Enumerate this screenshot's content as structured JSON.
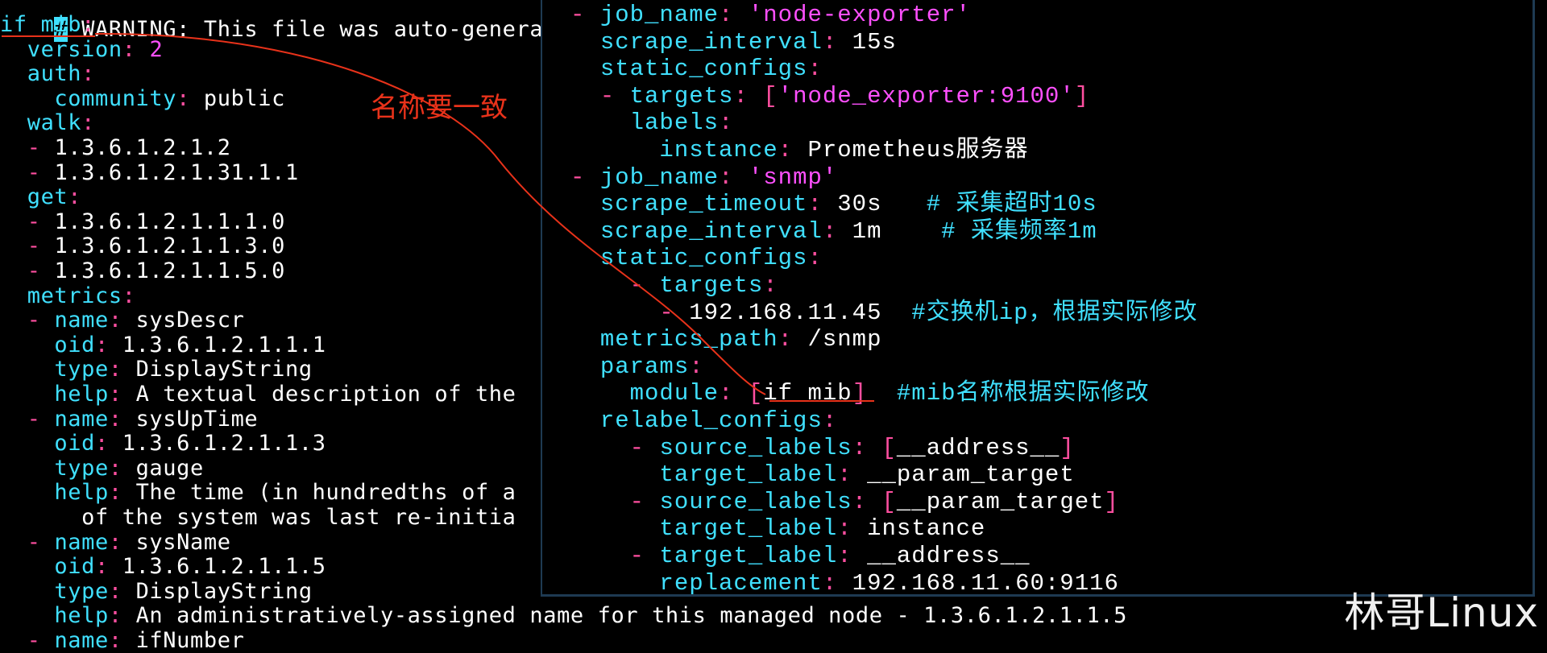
{
  "left_editor": {
    "warning": "# WARNING: This file was auto-generate",
    "lines": [
      {
        "indent": "",
        "key": "if_mib",
        "sep": ":",
        "val": "",
        "cursor": false
      },
      {
        "indent": "  ",
        "key": "version",
        "sep": ": ",
        "val": "2",
        "valtype": "num"
      },
      {
        "indent": "  ",
        "key": "auth",
        "sep": ":",
        "val": ""
      },
      {
        "indent": "    ",
        "key": "community",
        "sep": ": ",
        "val": "public"
      },
      {
        "indent": "  ",
        "key": "walk",
        "sep": ":",
        "val": ""
      },
      {
        "indent": "  ",
        "dash": "- ",
        "val": "1.3.6.1.2.1.2"
      },
      {
        "indent": "  ",
        "dash": "- ",
        "val": "1.3.6.1.2.1.31.1.1"
      },
      {
        "indent": "  ",
        "key": "get",
        "sep": ":",
        "val": ""
      },
      {
        "indent": "  ",
        "dash": "- ",
        "val": "1.3.6.1.2.1.1.1.0"
      },
      {
        "indent": "  ",
        "dash": "- ",
        "val": "1.3.6.1.2.1.1.3.0"
      },
      {
        "indent": "  ",
        "dash": "- ",
        "val": "1.3.6.1.2.1.1.5.0"
      },
      {
        "indent": "  ",
        "key": "metrics",
        "sep": ":",
        "val": ""
      },
      {
        "indent": "  ",
        "dash": "- ",
        "key": "name",
        "sep": ": ",
        "val": "sysDescr"
      },
      {
        "indent": "    ",
        "key": "oid",
        "sep": ": ",
        "val": "1.3.6.1.2.1.1.1"
      },
      {
        "indent": "    ",
        "key": "type",
        "sep": ": ",
        "val": "DisplayString"
      },
      {
        "indent": "    ",
        "key": "help",
        "sep": ": ",
        "val": "A textual description of the"
      },
      {
        "indent": "  ",
        "dash": "- ",
        "key": "name",
        "sep": ": ",
        "val": "sysUpTime"
      },
      {
        "indent": "    ",
        "key": "oid",
        "sep": ": ",
        "val": "1.3.6.1.2.1.1.3"
      },
      {
        "indent": "    ",
        "key": "type",
        "sep": ": ",
        "val": "gauge"
      },
      {
        "indent": "    ",
        "key": "help",
        "sep": ": ",
        "val": "The time (in hundredths of a"
      },
      {
        "indent": "      ",
        "val": "of the system was last re-initia"
      },
      {
        "indent": "  ",
        "dash": "- ",
        "key": "name",
        "sep": ": ",
        "val": "sysName"
      },
      {
        "indent": "    ",
        "key": "oid",
        "sep": ": ",
        "val": "1.3.6.1.2.1.1.5"
      },
      {
        "indent": "    ",
        "key": "type",
        "sep": ": ",
        "val": "DisplayString"
      },
      {
        "indent": "    ",
        "key": "help",
        "sep": ": ",
        "val": "An administratively-assigned name for this managed node - 1.3.6.1.2.1.1.5"
      },
      {
        "indent": "  ",
        "dash": "- ",
        "key": "name",
        "sep": ": ",
        "val": "ifNumber"
      }
    ]
  },
  "right_editor": {
    "lines": [
      {
        "indent": "",
        "dash": "- ",
        "key": "job_name",
        "sep": ": ",
        "val": "'node-exporter'",
        "valtype": "str"
      },
      {
        "indent": "  ",
        "key": "scrape_interval",
        "sep": ": ",
        "val": "15s"
      },
      {
        "indent": "  ",
        "key": "static_configs",
        "sep": ":",
        "val": ""
      },
      {
        "indent": "  ",
        "dash": "- ",
        "key": "targets",
        "sep": ": ",
        "val": "['node_exporter:9100']",
        "valtype": "str",
        "bracket": true
      },
      {
        "indent": "    ",
        "key": "labels",
        "sep": ":",
        "val": ""
      },
      {
        "indent": "      ",
        "key": "instance",
        "sep": ": ",
        "val": "Prometheus服务器"
      },
      {
        "indent": "",
        "dash": "- ",
        "key": "job_name",
        "sep": ": ",
        "val": "'snmp'",
        "valtype": "str"
      },
      {
        "indent": "  ",
        "key": "scrape_timeout",
        "sep": ": ",
        "val": "30s",
        "comment": "   # 采集超时10s"
      },
      {
        "indent": "  ",
        "key": "scrape_interval",
        "sep": ": ",
        "val": "1m",
        "comment": "    # 采集频率1m"
      },
      {
        "indent": "  ",
        "key": "static_configs",
        "sep": ":",
        "val": ""
      },
      {
        "indent": "    ",
        "dash": "- ",
        "key": "targets",
        "sep": ":",
        "val": ""
      },
      {
        "indent": "      ",
        "dash": "- ",
        "val": "192.168.11.45",
        "comment": "  #交换机ip，根据实际修改"
      },
      {
        "indent": "  ",
        "key": "metrics_path",
        "sep": ": ",
        "val": "/snmp"
      },
      {
        "indent": "  ",
        "key": "params",
        "sep": ":",
        "val": ""
      },
      {
        "indent": "    ",
        "key": "module",
        "sep": ": ",
        "val": "if_mib",
        "bracket_plain": true,
        "comment": "  #mib名称根据实际修改"
      },
      {
        "indent": "  ",
        "key": "relabel_configs",
        "sep": ":",
        "val": ""
      },
      {
        "indent": "    ",
        "dash": "- ",
        "key": "source_labels",
        "sep": ": ",
        "val": "__address__",
        "bracket_plain": true
      },
      {
        "indent": "      ",
        "key": "target_label",
        "sep": ": ",
        "val": "__param_target"
      },
      {
        "indent": "    ",
        "dash": "- ",
        "key": "source_labels",
        "sep": ": ",
        "val": "__param_target",
        "bracket_plain": true
      },
      {
        "indent": "      ",
        "key": "target_label",
        "sep": ": ",
        "val": "instance"
      },
      {
        "indent": "    ",
        "dash": "- ",
        "key": "target_label",
        "sep": ": ",
        "val": "__address__"
      },
      {
        "indent": "      ",
        "key": "replacement",
        "sep": ": ",
        "val": "192.168.11.60:9116"
      }
    ]
  },
  "annotation": {
    "text": "名称要一致",
    "color": "#e8321a"
  },
  "watermark": "林哥Linux",
  "colors": {
    "key": "#40e0ff",
    "punct": "#ff4fa0",
    "string": "#ff50ff",
    "text": "#ffffff",
    "background": "#000000",
    "annotation": "#e8321a"
  }
}
